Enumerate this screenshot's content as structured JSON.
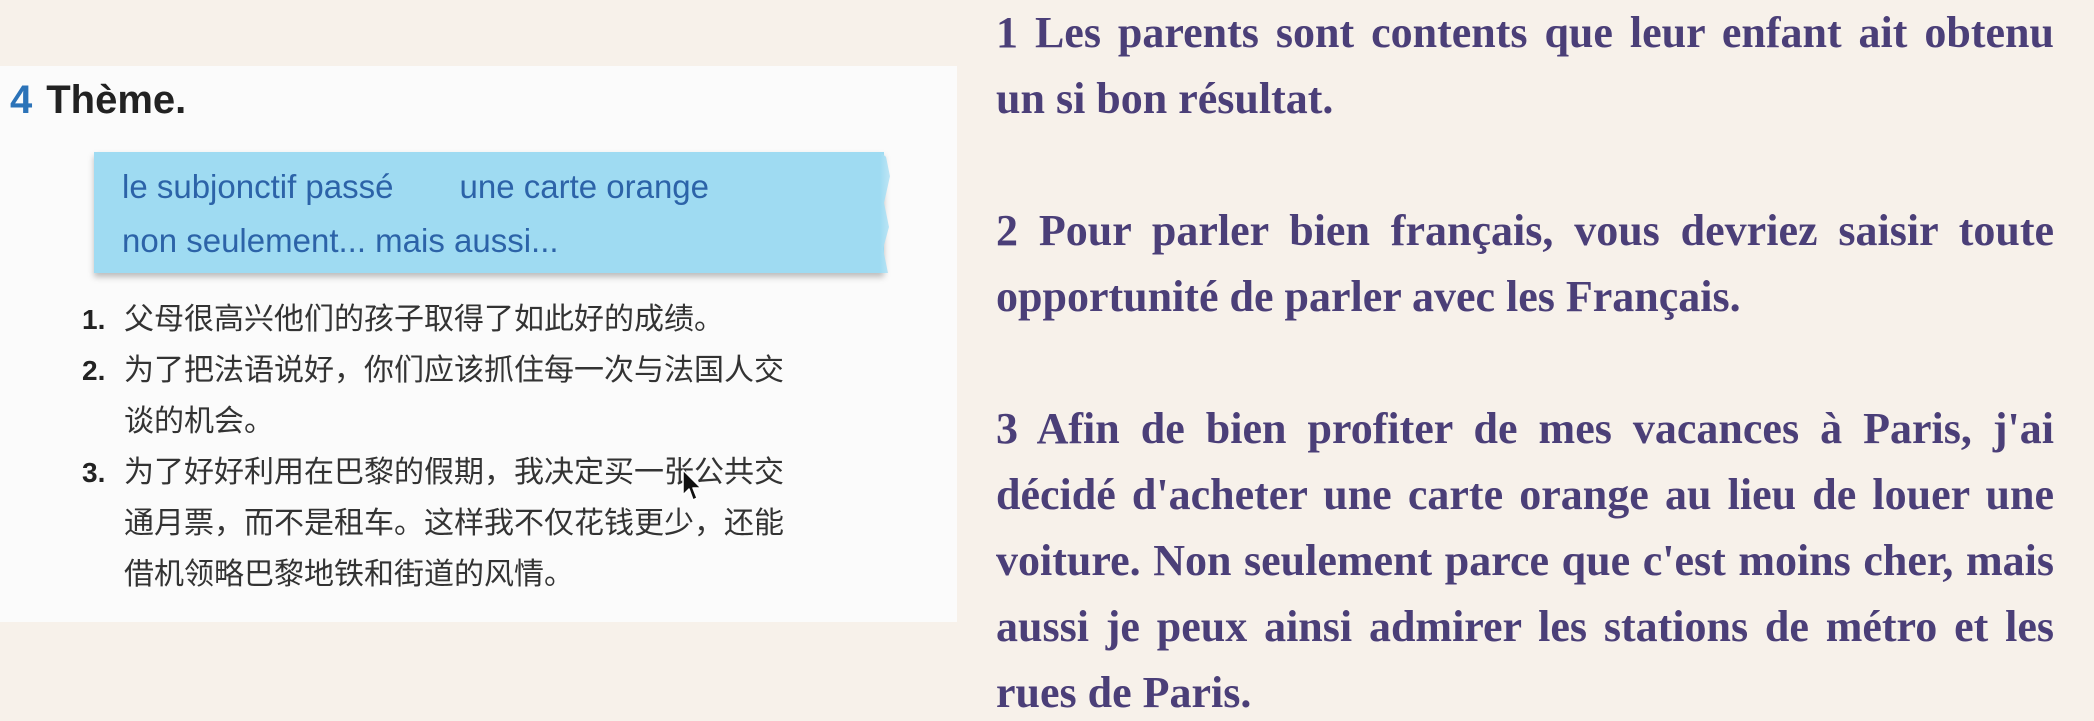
{
  "exercise": {
    "number": "4",
    "title": "Thème.",
    "vocab": {
      "row1_a": "le subjonctif passé",
      "row1_b": "une carte orange",
      "row2": "non seulement... mais aussi..."
    },
    "items": [
      {
        "num": "1.",
        "lines": [
          "父母很高兴他们的孩子取得了如此好的成绩。"
        ]
      },
      {
        "num": "2.",
        "lines": [
          "为了把法语说好，你们应该抓住每一次与法国人交",
          "谈的机会。"
        ]
      },
      {
        "num": "3.",
        "lines": [
          "为了好好利用在巴黎的假期，我决定买一张公共交",
          "通月票，而不是租车。这样我不仅花钱更少，还能",
          "借机领略巴黎地铁和街道的风情。"
        ]
      }
    ]
  },
  "translations": [
    "1 Les parents sont contents que leur enfant ait obtenu un si bon résultat.",
    "2 Pour parler bien français, vous devriez saisir toute opportunité de parler avec les Français.",
    "3 Afin de bien profiter de mes vacances à Paris, j'ai décidé d'acheter une carte orange au lieu de louer une voiture. Non seulement parce que c'est moins cher, mais aussi je peux ainsi admirer les stations de métro et les rues de Paris."
  ],
  "colors": {
    "background": "#f7f1ea",
    "exercise_number": "#2c73b8",
    "vocab_box": "#9fdbf2",
    "vocab_text": "#2c63a8",
    "translation_text": "#4b3f78"
  },
  "icons": [
    "mouse-cursor-icon"
  ]
}
